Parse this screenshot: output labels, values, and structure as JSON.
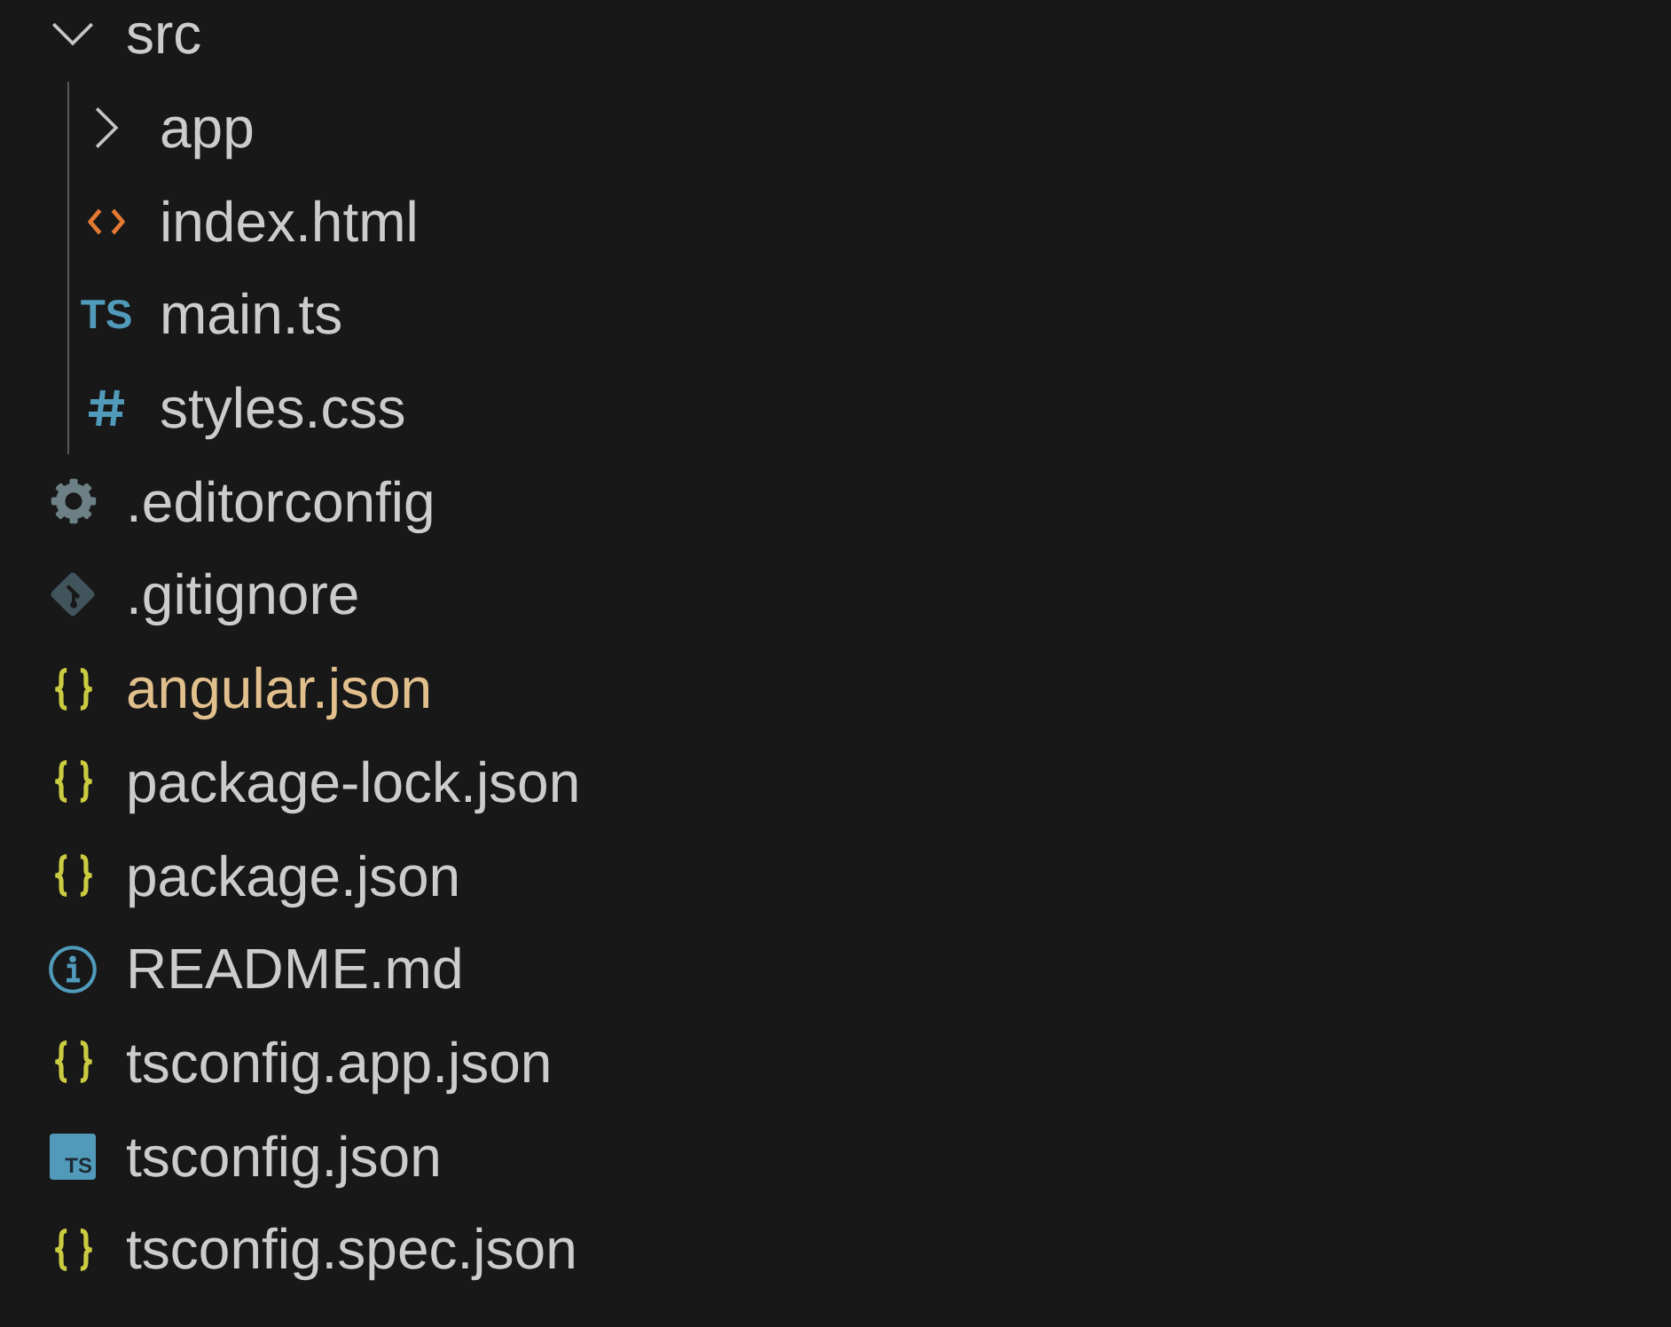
{
  "explorer": {
    "items": [
      {
        "name": "src",
        "kind": "folder",
        "expanded": true,
        "modified": false,
        "children": [
          {
            "name": "app",
            "kind": "folder",
            "expanded": false,
            "modified": false
          },
          {
            "name": "index.html",
            "kind": "html",
            "modified": false
          },
          {
            "name": "main.ts",
            "kind": "typescript",
            "badge": "TS",
            "modified": false
          },
          {
            "name": "styles.css",
            "kind": "css",
            "modified": false
          }
        ]
      },
      {
        "name": ".editorconfig",
        "kind": "config",
        "modified": false
      },
      {
        "name": ".gitignore",
        "kind": "git",
        "modified": false
      },
      {
        "name": "angular.json",
        "kind": "json",
        "modified": true
      },
      {
        "name": "package-lock.json",
        "kind": "json",
        "modified": false
      },
      {
        "name": "package.json",
        "kind": "json",
        "modified": false
      },
      {
        "name": "README.md",
        "kind": "info",
        "modified": false
      },
      {
        "name": "tsconfig.app.json",
        "kind": "json",
        "modified": false
      },
      {
        "name": "tsconfig.json",
        "kind": "tsconfig",
        "badge": "TS",
        "modified": false
      },
      {
        "name": "tsconfig.spec.json",
        "kind": "json",
        "modified": false
      }
    ]
  }
}
